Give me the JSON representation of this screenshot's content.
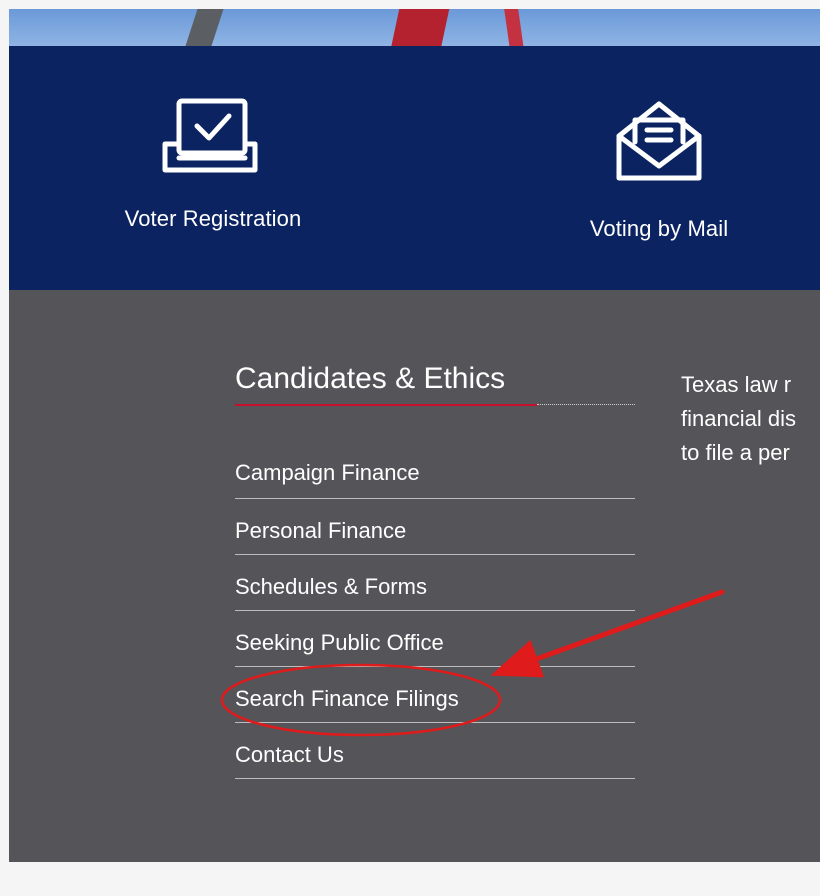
{
  "quick_links": [
    {
      "label": "Voter Registration",
      "icon": "ballot-box-checkmark-icon"
    },
    {
      "label": "Voting by Mail",
      "icon": "open-envelope-letter-icon"
    }
  ],
  "candidates": {
    "heading": "Candidates & Ethics",
    "links": [
      {
        "label": "Campaign Finance"
      },
      {
        "label": "Personal Finance"
      },
      {
        "label": "Schedules & Forms"
      },
      {
        "label": "Seeking Public Office"
      },
      {
        "label": "Search Finance Filings"
      },
      {
        "label": "Contact Us"
      }
    ],
    "blurb_lines": [
      "Texas law r",
      "financial dis",
      "to file a per"
    ]
  },
  "colors": {
    "band_blue": "#0b2360",
    "section_grey": "#555559",
    "accent_red": "#c8102e",
    "annotation_red": "#e01b1b"
  }
}
